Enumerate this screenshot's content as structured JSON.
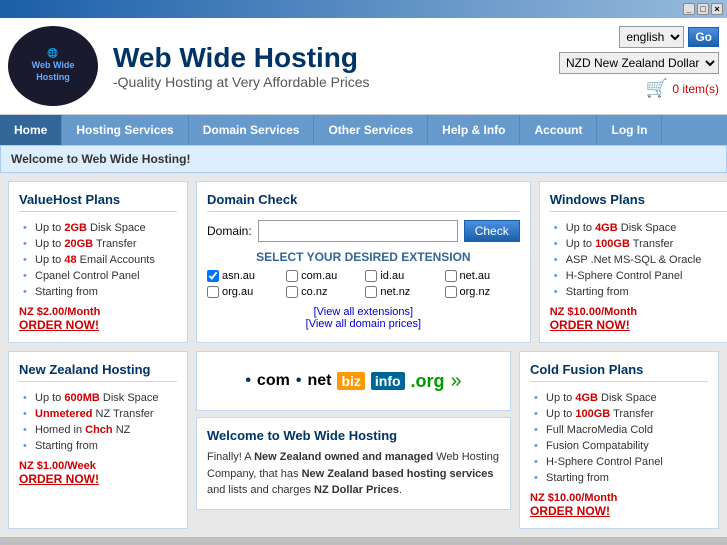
{
  "titlebar": {
    "min_label": "_",
    "max_label": "□",
    "close_label": "×"
  },
  "header": {
    "logo_line1": "Web Wide",
    "logo_line2": "Hosting",
    "title": "Web Wide Hosting",
    "tagline": "-Quality Hosting at Very Affordable Prices",
    "lang_value": "english",
    "go_label": "Go",
    "currency_value": "NZD New Zealand Dollar",
    "cart_count": "0 item(s)"
  },
  "nav": {
    "items": [
      {
        "label": "Home",
        "active": true
      },
      {
        "label": "Hosting Services",
        "active": false
      },
      {
        "label": "Domain Services",
        "active": false
      },
      {
        "label": "Other Services",
        "active": false
      },
      {
        "label": "Help & Info",
        "active": false
      },
      {
        "label": "Account",
        "active": false
      },
      {
        "label": "Log In",
        "active": false
      }
    ]
  },
  "welcome_bar": "Welcome to Web Wide Hosting!",
  "valuehost": {
    "title": "ValueHost Plans",
    "features": [
      {
        "text": "Up to ",
        "bold": "2GB",
        "rest": " Disk Space"
      },
      {
        "text": "Up to ",
        "bold": "20GB",
        "rest": " Transfer"
      },
      {
        "text": "Up to ",
        "bold": "48",
        "rest": " Email Accounts"
      },
      {
        "text": "Cpanel Control Panel"
      },
      {
        "text": "Starting from"
      }
    ],
    "price": "NZ $2.00/Month",
    "order": "ORDER NOW!"
  },
  "domaincheck": {
    "title": "Domain Check",
    "domain_label": "Domain:",
    "domain_placeholder": "",
    "check_btn": "Check",
    "select_text": "SELECT YOUR DESIRED EXTENSION",
    "extensions": [
      "asn.au",
      "com.au",
      "id.au",
      "net.au",
      "org.au",
      "co.nz",
      "net.nz",
      "org.nz"
    ],
    "view_extensions": "[View all extensions]",
    "view_prices": "[View all domain prices]"
  },
  "windows": {
    "title": "Windows Plans",
    "features": [
      {
        "text": "Up to ",
        "bold": "4GB",
        "rest": " Disk Space"
      },
      {
        "text": "Up to ",
        "bold": "100GB",
        "rest": " Transfer"
      },
      {
        "text": "ASP .Net MS-SQL & Oracle"
      },
      {
        "text": "H-Sphere Control Panel"
      },
      {
        "text": "Starting from"
      }
    ],
    "price": "NZ $10.00/Month",
    "order": "ORDER NOW!"
  },
  "nzhosting": {
    "title": "New Zealand Hosting",
    "features": [
      {
        "text": "Up to ",
        "bold": "600MB",
        "rest": " Disk Space"
      },
      {
        "text": "",
        "bold": "Unmetered",
        "rest": " NZ Transfer"
      },
      {
        "text": "Homed in ",
        "bold": "Chch",
        "rest": " NZ"
      },
      {
        "text": "Starting from"
      }
    ],
    "price": "NZ $1.00/Week",
    "order": "ORDER NOW!"
  },
  "tld_banner": {
    "items": [
      ".com",
      ".net",
      ".biz",
      ".info",
      ".org"
    ]
  },
  "welcome_panel": {
    "title": "Welcome to Web Wide Hosting",
    "text_plain1": "Finally! A ",
    "text_bold1": "New Zealand owned and managed",
    "text_plain2": " Web Hosting Company, that has ",
    "text_bold2": "New Zealand based hosting services",
    "text_plain3": " and lists and charges ",
    "text_bold3": "NZ Dollar Prices",
    "text_plain4": "."
  },
  "coldfusion": {
    "title": "Cold Fusion Plans",
    "features": [
      {
        "text": "Up to ",
        "bold": "4GB",
        "rest": " Disk Space"
      },
      {
        "text": "Up to ",
        "bold": "100GB",
        "rest": " Transfer"
      },
      {
        "text": "Full MacroMedia Cold"
      },
      {
        "text": "Fusion Compatability"
      },
      {
        "text": "H-Sphere Control Panel"
      },
      {
        "text": "Starting from"
      }
    ],
    "price": "NZ $10.00/Month",
    "order": "ORDER NOW!"
  }
}
